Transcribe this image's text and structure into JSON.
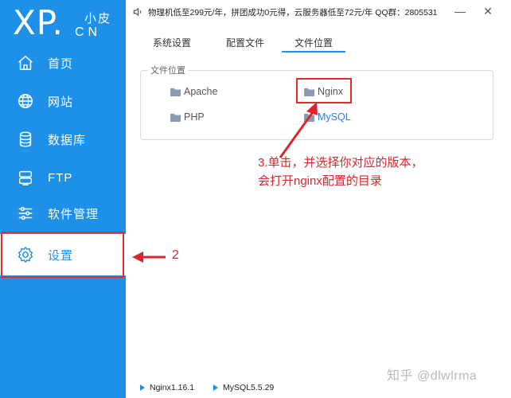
{
  "logo": {
    "xp": "XP.",
    "top": "小皮",
    "bottom": "CN"
  },
  "sidebar": {
    "items": [
      {
        "label": "首页",
        "icon": "home-icon"
      },
      {
        "label": "网站",
        "icon": "globe-icon"
      },
      {
        "label": "数据库",
        "icon": "database-icon"
      },
      {
        "label": "FTP",
        "icon": "server-icon"
      },
      {
        "label": "软件管理",
        "icon": "sliders-icon"
      },
      {
        "label": "设置",
        "icon": "gear-icon"
      }
    ],
    "active_index": 5
  },
  "notice": {
    "text": "物理机低至299元/年，拼团成功0元得，云服务器低至72元/年 QQ群：2805531"
  },
  "window": {
    "minimize": "—",
    "close": "✕"
  },
  "tabs": [
    {
      "label": "系统设置"
    },
    {
      "label": "配置文件"
    },
    {
      "label": "文件位置"
    }
  ],
  "active_tab": 2,
  "panel": {
    "title": "文件位置",
    "folders": [
      "Apache",
      "Nginx",
      "PHP",
      "MySQL"
    ]
  },
  "annotations": {
    "step3_line1": "3.单击，并选择你对应的版本，",
    "step3_line2": "会打开nginx配置的目录",
    "step2": "2"
  },
  "status": {
    "nginx": "Nginx1.16.1",
    "mysql": "MySQL5.5.29"
  },
  "watermark": "知乎 @dlwlrma",
  "colors": {
    "brand": "#1e90e8",
    "annotation": "#d8262c"
  }
}
